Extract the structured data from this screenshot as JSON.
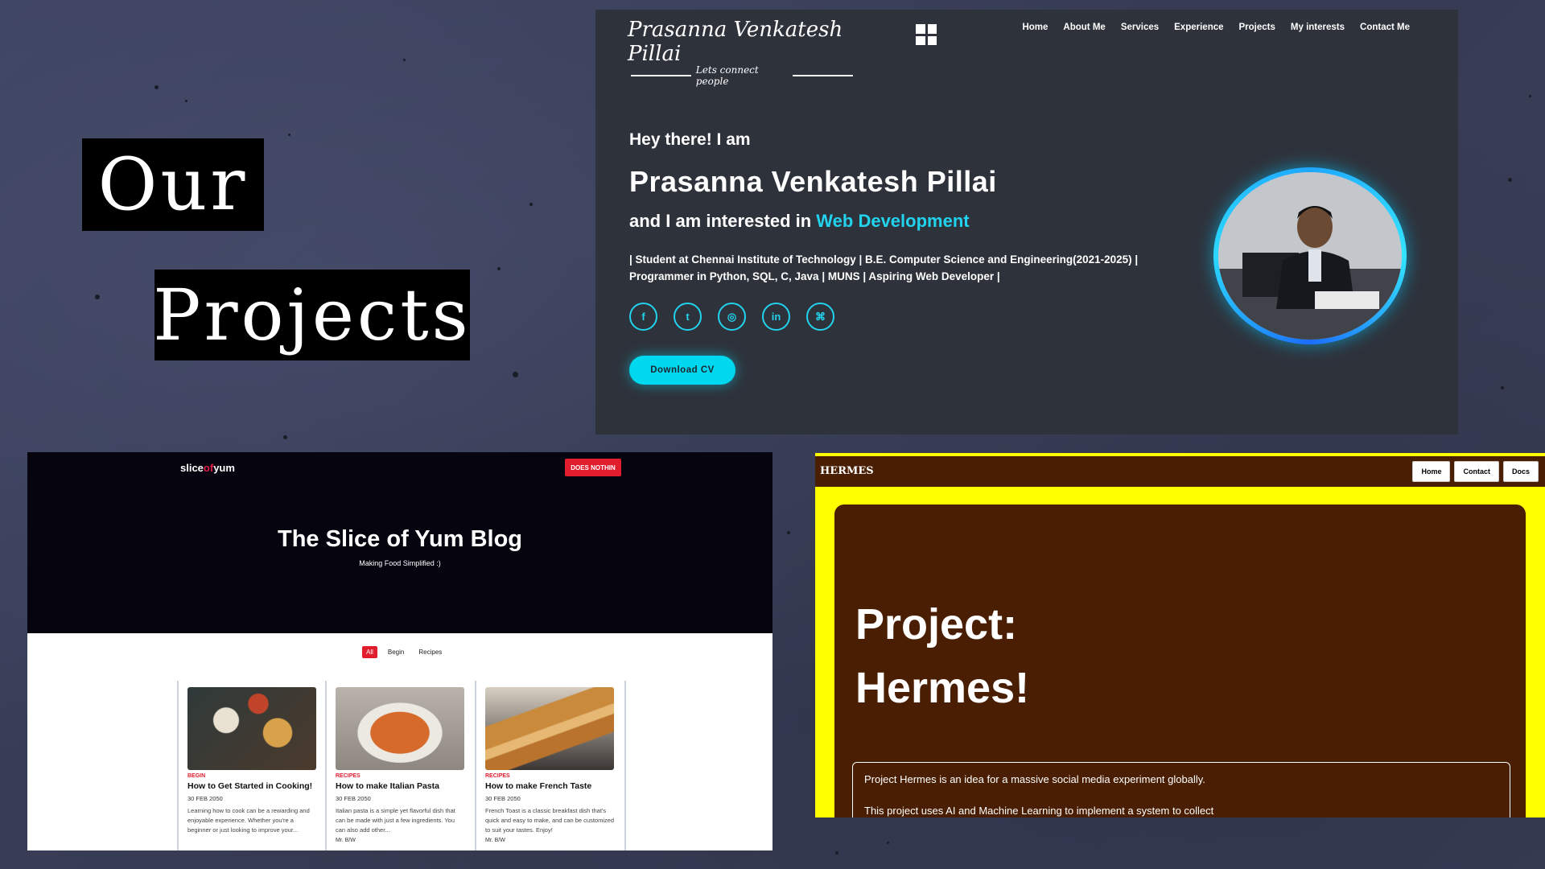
{
  "slide": {
    "title_line1": "Our",
    "title_line2": "Projects"
  },
  "portfolio": {
    "logo_name": "Prasanna Venkatesh Pillai",
    "logo_tagline": "Lets connect people",
    "nav": [
      "Home",
      "About Me",
      "Services",
      "Experience",
      "Projects",
      "My interests",
      "Contact Me"
    ],
    "greeting": "Hey there! I am",
    "name": "Prasanna Venkatesh Pillai",
    "interest_prefix": "and I am interested in",
    "interest_highlight": "Web Development",
    "bio_line1": "| Student at Chennai Institute of Technology | B.E. Computer Science and Engineering(2021-2025) |",
    "bio_line2": "Programmer in Python, SQL, C, Java | MUNS | Aspiring Web Developer |",
    "socials": [
      {
        "icon": "facebook-icon",
        "glyph": "f"
      },
      {
        "icon": "twitter-icon",
        "glyph": "t"
      },
      {
        "icon": "instagram-icon",
        "glyph": "◎"
      },
      {
        "icon": "linkedin-icon",
        "glyph": "in"
      },
      {
        "icon": "github-icon",
        "glyph": "⌘"
      }
    ],
    "cv_button": "Download CV",
    "accent_color": "#22d3ee"
  },
  "foodblog": {
    "logo_a": "slice",
    "logo_b": "of",
    "logo_c": "yum",
    "badge": "DOES NOTHIN",
    "title": "The Slice of Yum Blog",
    "subtitle": "Making Food Simplified :)",
    "filters": [
      "All",
      "Begin",
      "Recipes"
    ],
    "cards": [
      {
        "category": "BEGIN",
        "title": "How to Get Started in Cooking!",
        "date": "30 FEB 2050",
        "excerpt": "Learning how to cook can be a rewarding and enjoyable experience. Whether you're a beginner or just looking to improve your..."
      },
      {
        "category": "RECIPES",
        "title": "How to make Italian Pasta",
        "date": "30 FEB 2050",
        "excerpt": "Italian pasta is a simple yet flavorful dish that can be made with just a few ingredients. You can also add other...",
        "author": "Mr. B/W"
      },
      {
        "category": "RECIPES",
        "title": "How to make French Taste",
        "date": "30 FEB 2050",
        "excerpt": "French Toast is a classic breakfast dish that's quick and easy to make, and can be customized to suit your tastes. Enjoy!",
        "author": "Mr. B/W"
      }
    ],
    "accent_color": "#e11d2e"
  },
  "hermes": {
    "logo": "HERMES",
    "nav": [
      "Home",
      "Contact",
      "Docs"
    ],
    "heading_line1": "Project:",
    "heading_line2": "Hermes!",
    "desc_line1": "Project Hermes is an idea for a massive social media experiment globally.",
    "desc_line2": "This project uses AI and Machine Learning to implement a system to collect",
    "bg_color": "#ffff00",
    "panel_color": "#4a1e03"
  }
}
